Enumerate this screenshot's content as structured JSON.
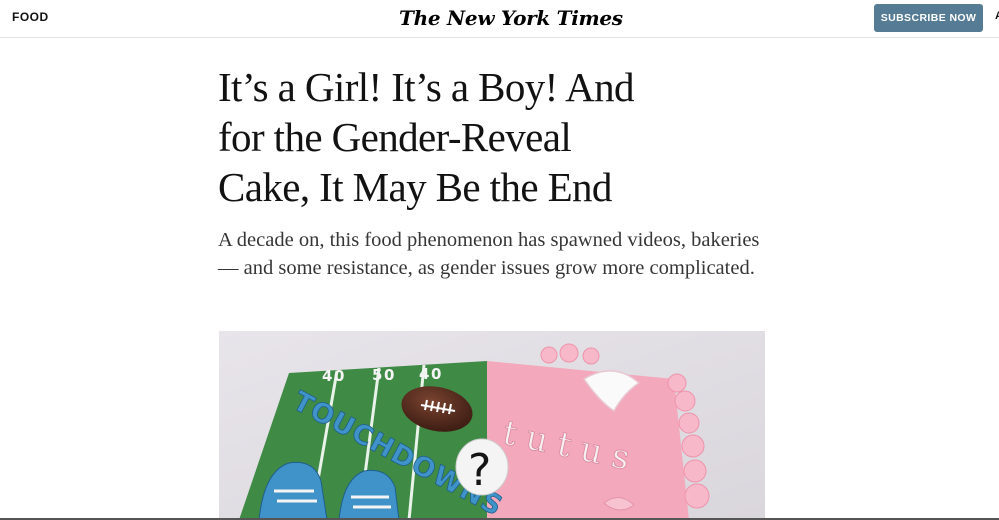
{
  "header": {
    "section_label": "FOOD",
    "masthead": "The New York Times",
    "subscribe_label": "SUBSCRIBE NOW",
    "clipped_label": "A"
  },
  "article": {
    "headline": "It’s a Girl! It’s a Boy! And for the Gender-Reveal Cake, It May Be the End",
    "summary": "A decade on, this food phenomenon has spawned videos, bakeries — and some resistance, as gender issues grow more complicated."
  },
  "lead_image": {
    "yard_markers": [
      "4",
      "0",
      "5",
      "0",
      "4",
      "0"
    ],
    "left_text": "TOUCHDOWNS",
    "right_text": "tutus",
    "question_mark": "?",
    "colors": {
      "field_green": "#3f8a45",
      "cake_pink": "#f4a8bc",
      "lettering_blue": "#3f93c9",
      "football_brown": "#5a2d1c"
    }
  },
  "colors": {
    "subscribe_bg": "#567b95",
    "text_primary": "#121212",
    "text_secondary": "#363636"
  }
}
